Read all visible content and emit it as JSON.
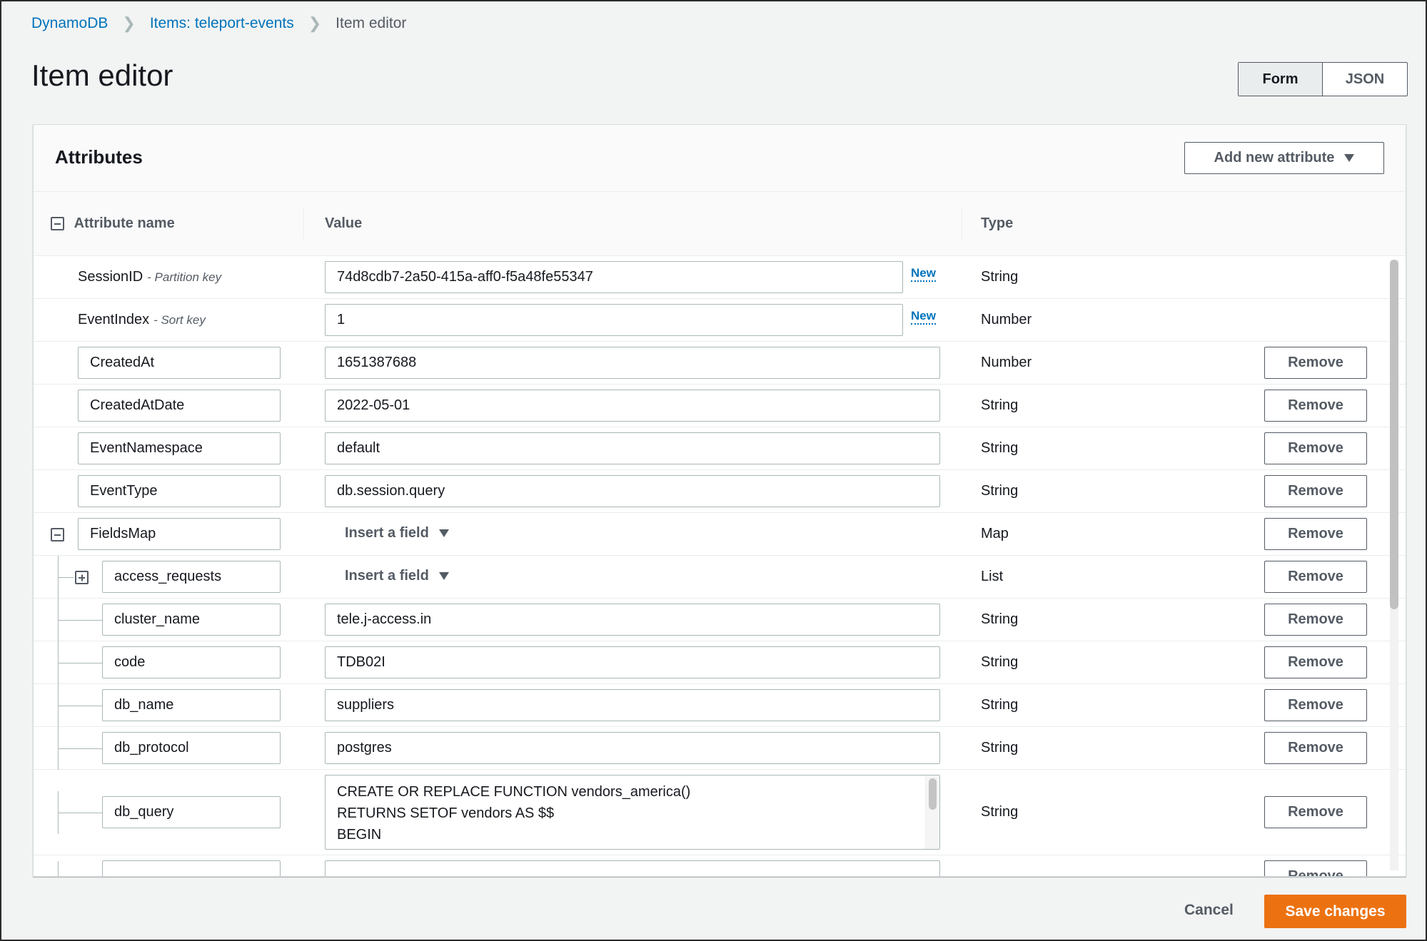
{
  "breadcrumb": [
    {
      "label": "DynamoDB",
      "link": true
    },
    {
      "label": "Items: teleport-events",
      "link": true
    },
    {
      "label": "Item editor",
      "link": false
    }
  ],
  "page_title": "Item editor",
  "view_toggle": {
    "options": [
      "Form",
      "JSON"
    ],
    "selected": "Form"
  },
  "card": {
    "title": "Attributes",
    "add_attribute_label": "Add new attribute"
  },
  "table": {
    "headers": {
      "name": "Attribute name",
      "value": "Value",
      "type": "Type"
    },
    "new_badge": "New",
    "remove_label": "Remove",
    "insert_field_label": "Insert a field",
    "keys": [
      {
        "name": "SessionID",
        "hint": "- Partition key",
        "value": "74d8cdb7-2a50-415a-aff0-f5a48fe55347",
        "type": "String"
      },
      {
        "name": "EventIndex",
        "hint": "- Sort key",
        "value": "1",
        "type": "Number"
      }
    ],
    "attributes": [
      {
        "name": "CreatedAt",
        "value": "1651387688",
        "type": "Number"
      },
      {
        "name": "CreatedAtDate",
        "value": "2022-05-01",
        "type": "String"
      },
      {
        "name": "EventNamespace",
        "value": "default",
        "type": "String"
      },
      {
        "name": "EventType",
        "value": "db.session.query",
        "type": "String"
      },
      {
        "name": "FieldsMap",
        "type": "Map"
      }
    ],
    "fields_map": [
      {
        "name": "access_requests",
        "type": "List"
      },
      {
        "name": "cluster_name",
        "value": "tele.j-access.in",
        "type": "String"
      },
      {
        "name": "code",
        "value": "TDB02I",
        "type": "String"
      },
      {
        "name": "db_name",
        "value": "suppliers",
        "type": "String"
      },
      {
        "name": "db_protocol",
        "value": "postgres",
        "type": "String"
      },
      {
        "name": "db_query",
        "value_lines": [
          "CREATE OR REPLACE FUNCTION vendors_america()",
          "RETURNS SETOF vendors AS $$",
          "BEGIN"
        ],
        "type": "String"
      }
    ]
  },
  "footer": {
    "cancel_label": "Cancel",
    "save_label": "Save changes"
  },
  "colors": {
    "link": "#0073bb",
    "primary": "#ec7211",
    "text": "#16191f",
    "muted": "#545b64"
  }
}
